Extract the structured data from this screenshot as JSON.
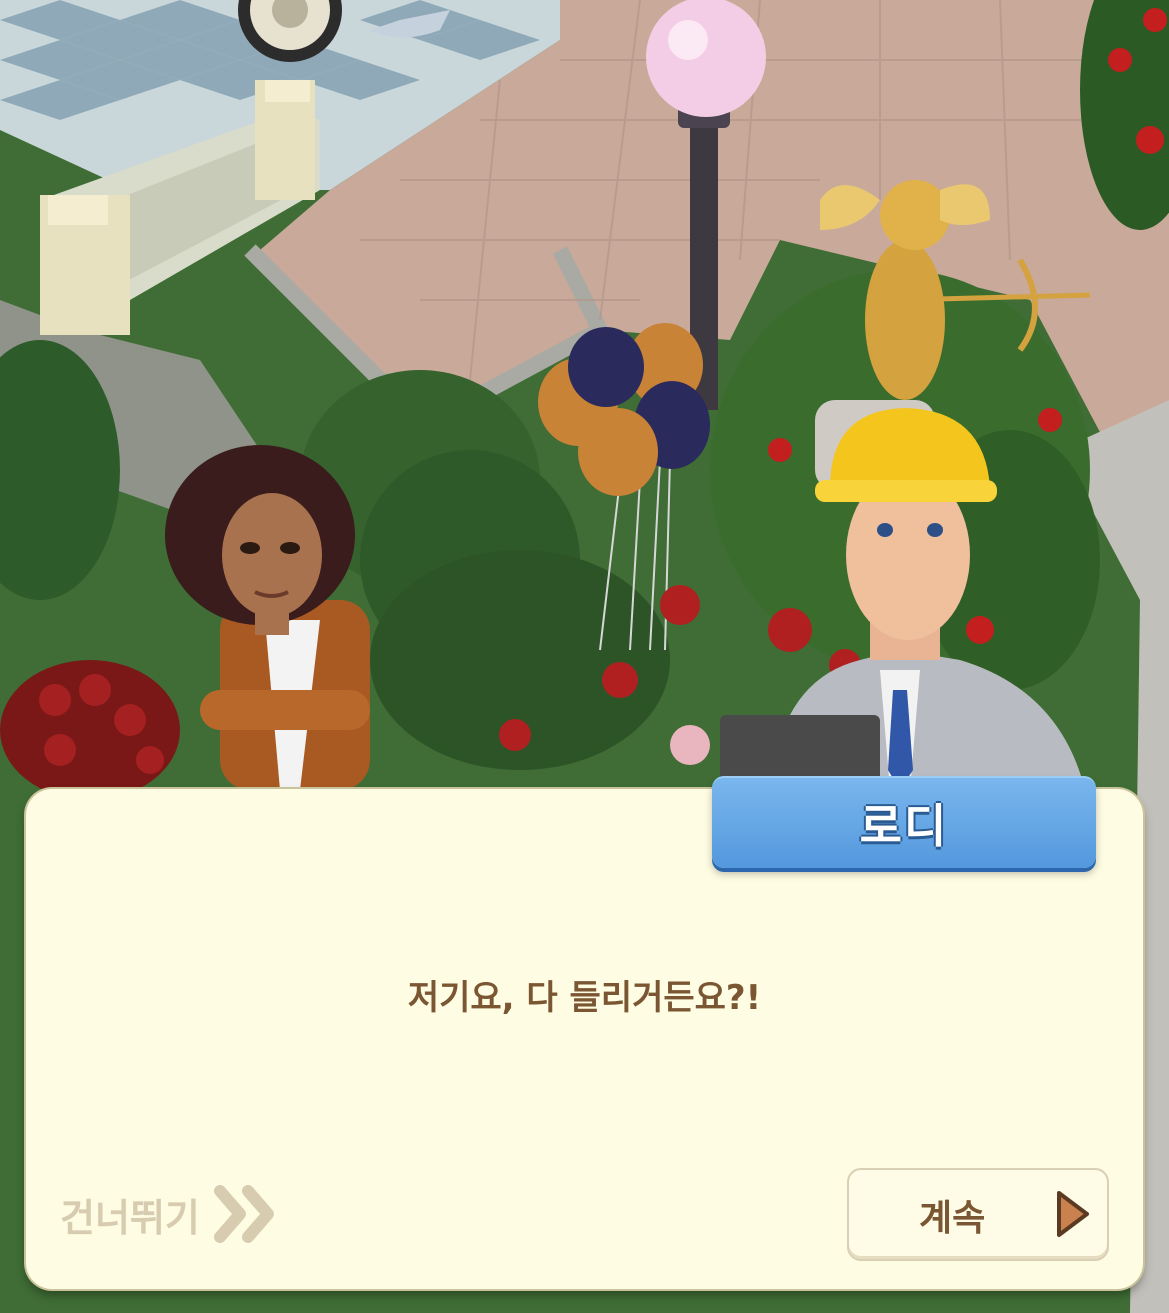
{
  "dialog": {
    "speaker_name": "로디",
    "message": "저기요, 다 들리거든요?!",
    "skip_label": "건너뛰기",
    "continue_label": "계속"
  },
  "colors": {
    "dialog_background": "#fefce2",
    "name_tag": "#5b9fe0",
    "text_brown": "#7a5633",
    "skip_text": "#d7cbb0",
    "continue_arrow": "#c9824d"
  },
  "icons": {
    "skip": "double-chevron-right-icon",
    "continue": "play-arrow-icon"
  }
}
